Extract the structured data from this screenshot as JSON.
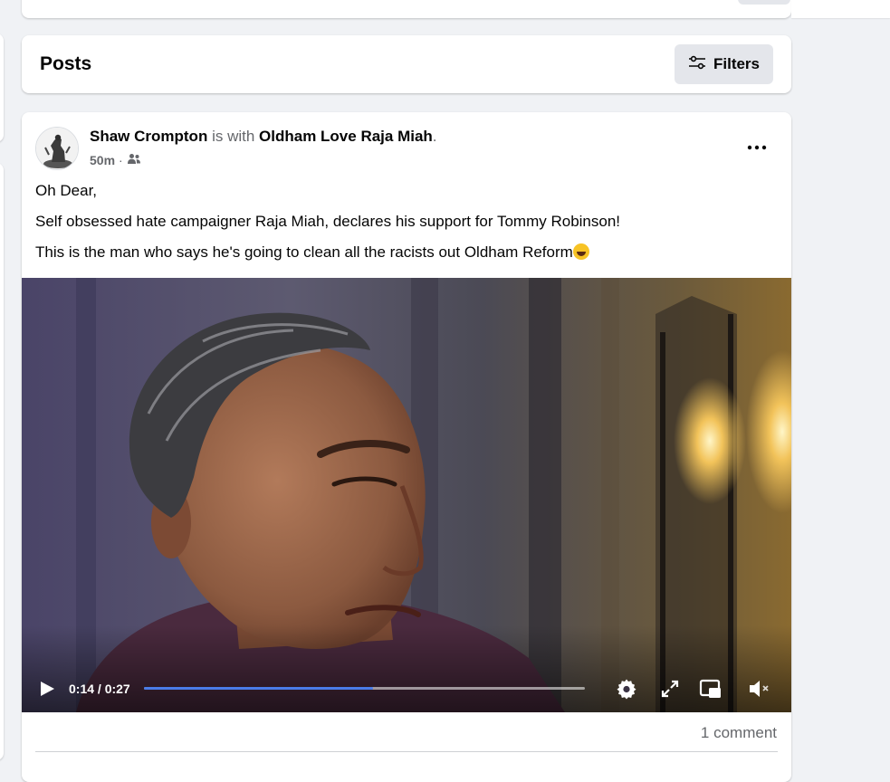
{
  "posts_header": {
    "title": "Posts",
    "filters_label": "Filters"
  },
  "post": {
    "author": "Shaw Crompton",
    "with_text": " is with ",
    "tagged": "Oldham Love Raja Miah",
    "tagged_suffix": ".",
    "timestamp": "50m",
    "separator": " · ",
    "audience_icon": "friends-icon",
    "lines": [
      "Oh Dear,",
      "Self obsessed hate campaigner Raja Miah, declares his support for Tommy Robinson!",
      "This is the man who says he's going to clean all the racists out Oldham Reform"
    ],
    "emoji": "rolling-on-floor-laughing-emoji",
    "video": {
      "current_time": "0:14",
      "duration": "0:27",
      "time_display": "0:14 / 0:27",
      "progress_fraction": 0.52
    },
    "comment_count": "1 comment"
  },
  "colors": {
    "page_bg": "#f0f2f5",
    "card_bg": "#ffffff",
    "secondary_text": "#65676b",
    "progress_accent": "#4a7ce8",
    "button_bg": "#e4e6eb"
  }
}
